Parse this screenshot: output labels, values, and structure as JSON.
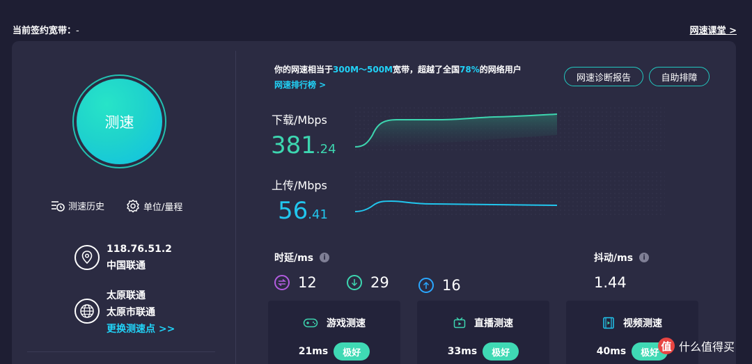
{
  "header": {
    "contract_label": "当前签约宽带：",
    "contract_value": "-",
    "classroom_link": "网速课堂 >"
  },
  "left": {
    "speed_button": "测速",
    "history": "测速历史",
    "unit": "单位/量程",
    "ip": "118.76.51.2",
    "isp": "中国联通",
    "node_name": "太原联通",
    "node_city": "太原市联通",
    "change_node": "更换测速点 >>"
  },
  "summary": {
    "prefix": "你的网速相当于",
    "range": "300M～500M",
    "mid": "宽带，超越了全国",
    "percent": "78%",
    "suffix": "的网络用户",
    "rank_link": "网速排行榜 >"
  },
  "buttons": {
    "report": "网速诊断报告",
    "self_check": "自助排障"
  },
  "download": {
    "label": "下载/Mbps",
    "int": "381",
    "dec": ".24",
    "color": "#3dd6b0"
  },
  "upload": {
    "label": "上传/Mbps",
    "int": "56",
    "dec": ".41",
    "color": "#21c6ee"
  },
  "latency": {
    "label": "时延/ms",
    "info": "i",
    "bidirectional": "12",
    "down": "29",
    "up": "16"
  },
  "jitter": {
    "label": "抖动/ms",
    "info": "i",
    "value": "1.44"
  },
  "cards": [
    {
      "title": "游戏测速",
      "ms": "21ms",
      "rating": "极好"
    },
    {
      "title": "直播测速",
      "ms": "33ms",
      "rating": "极好"
    },
    {
      "title": "视频测速",
      "ms": "40ms",
      "rating": "极好"
    }
  ],
  "watermark": {
    "logo": "值",
    "text": "什么值得买"
  }
}
